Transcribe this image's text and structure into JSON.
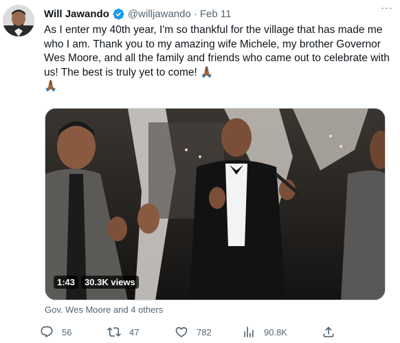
{
  "author": {
    "name": "Will Jawando",
    "handle": "@willjawando",
    "date": "Feb 11",
    "separator": "·"
  },
  "tweet": {
    "text": "As I enter my 40th year, I'm so thankful for the village that has made me who I am. Thank you to my amazing wife Michele, my brother Governor Wes Moore, and all the family and friends who came out to celebrate with us! The best is truly yet to come! 🙏🏾\n🙏🏾"
  },
  "video": {
    "duration": "1:43",
    "views": "30.3K views"
  },
  "tagged": "Gov. Wes Moore and 4 others",
  "more_label": "···",
  "actions": {
    "replies": "56",
    "reposts": "47",
    "likes": "782",
    "views": "90.8K"
  },
  "colors": {
    "verified": "#1d9bf0",
    "secondary_text": "#536471",
    "primary_text": "#0f1419"
  },
  "icons": [
    "verified-badge-icon",
    "more-icon",
    "reply-icon",
    "repost-icon",
    "like-icon",
    "views-icon",
    "share-icon"
  ]
}
